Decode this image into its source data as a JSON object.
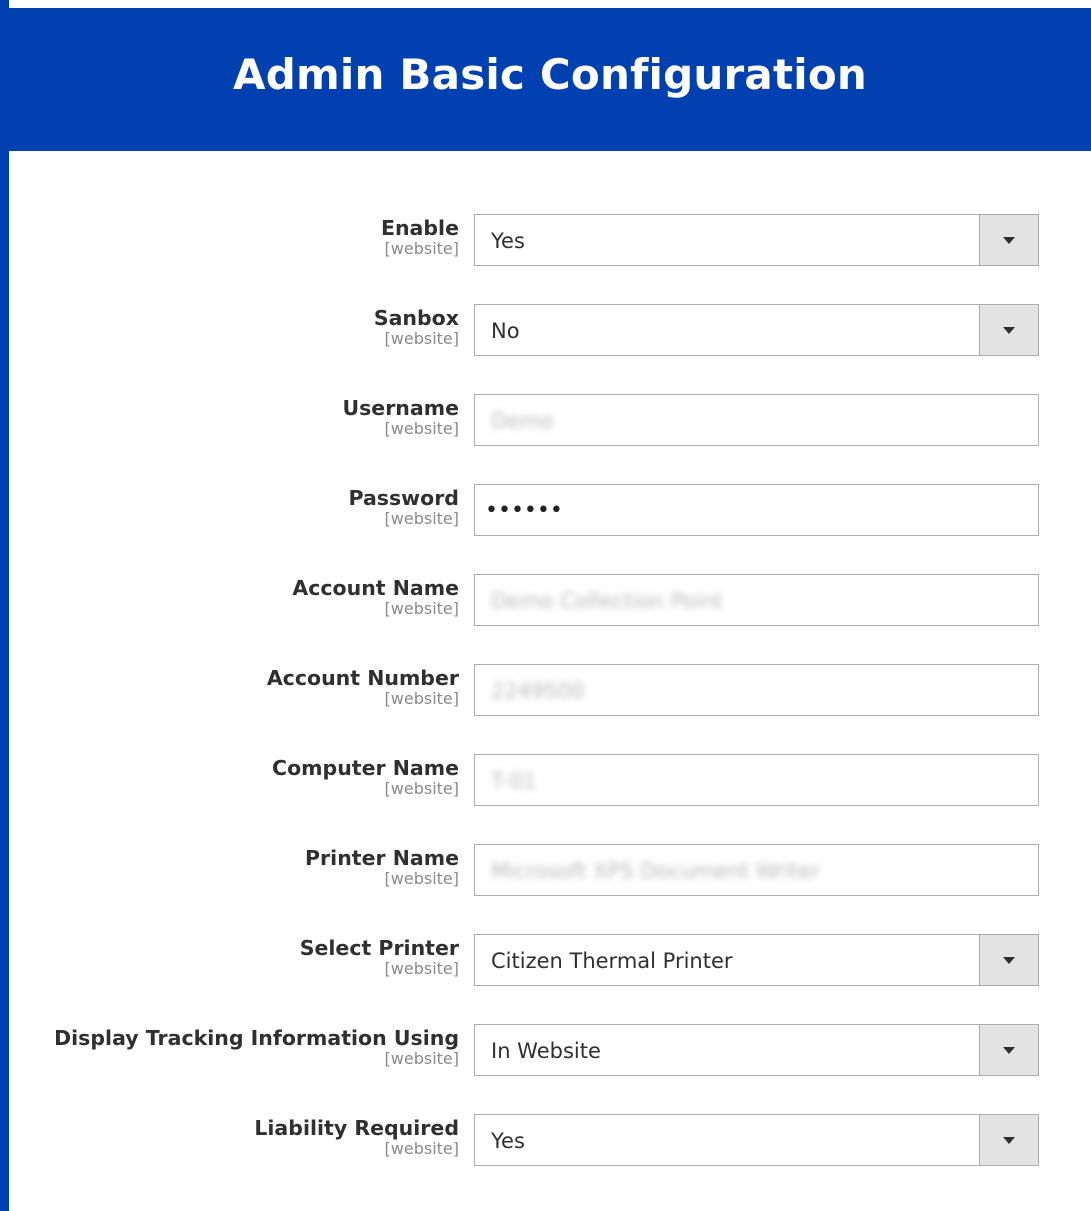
{
  "header": {
    "title": "Admin Basic Configuration"
  },
  "colors": {
    "header_bg": "#0040b0",
    "select_arrow_bg": "#e3e3e3"
  },
  "fields": {
    "enable": {
      "label": "Enable",
      "scope": "[website]",
      "value": "Yes"
    },
    "sanbox": {
      "label": "Sanbox",
      "scope": "[website]",
      "value": "No"
    },
    "username": {
      "label": "Username",
      "scope": "[website]",
      "value": "Demo"
    },
    "password": {
      "label": "Password",
      "scope": "[website]",
      "value": "••••••"
    },
    "account_name": {
      "label": "Account Name",
      "scope": "[website]",
      "value": "Demo Collection Point"
    },
    "account_number": {
      "label": "Account Number",
      "scope": "[website]",
      "value": "2249500"
    },
    "computer_name": {
      "label": "Computer Name",
      "scope": "[website]",
      "value": "T-01"
    },
    "printer_name": {
      "label": "Printer Name",
      "scope": "[website]",
      "value": "Microsoft XPS Document Writer"
    },
    "select_printer": {
      "label": "Select Printer",
      "scope": "[website]",
      "value": "Citizen Thermal Printer"
    },
    "display_tracking": {
      "label": "Display Tracking Information Using",
      "scope": "[website]",
      "value": "In Website"
    },
    "liability_required": {
      "label": "Liability Required",
      "scope": "[website]",
      "value": "Yes"
    }
  },
  "icons": {
    "dropdown": "chevron-down-icon"
  }
}
